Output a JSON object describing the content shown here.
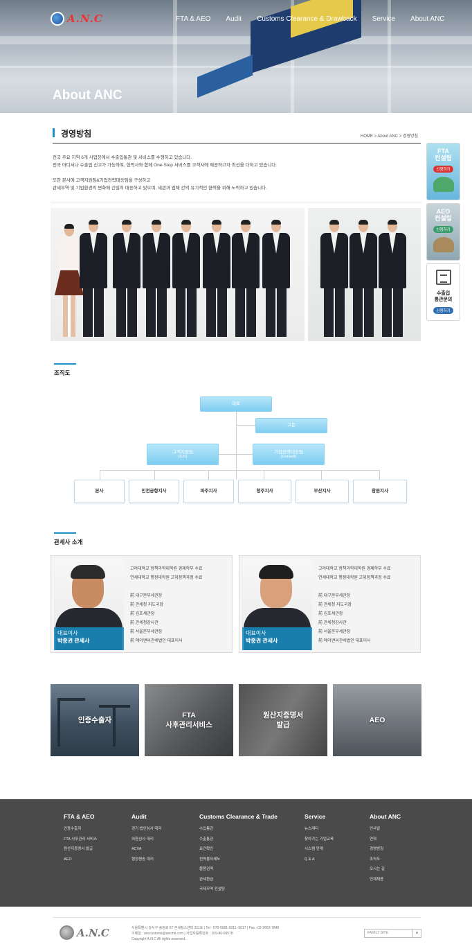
{
  "header": {
    "logo_text": "A.N.C",
    "nav": [
      "FTA & AEO",
      "Audit",
      "Customs Clearance & Drawback",
      "Service",
      "About ANC"
    ],
    "hero_title": "About ANC"
  },
  "page": {
    "title": "경영방침",
    "breadcrumb": "HOME  >  About ANC  >  경영방침",
    "intro": [
      "전국 주요 지역 6개 사업장에서 수출입통관 및 서비스를 수행하고 있습니다.",
      "전국 어디서나 수출입 신고가 가능하며, 협력사와 함께 One-Stop 서비스를 고객사에 제공하고자 최선을 다하고 있습니다.",
      "",
      "또한 본사에 고객지원팀&기업전략대응팀을 구성하고",
      "관세무역 및 기업환경의 변화에 긴밀히 대응하고 있으며, 세관과 업체 간의 유기적인 협력을 위해 노력하고 있습니다."
    ]
  },
  "quick_banners": [
    {
      "label": "FTA\n컨설팅",
      "pill": "신청하기",
      "icon": "globe-coin-icon"
    },
    {
      "label": "AEO\n컨설팅",
      "pill": "신청하기",
      "icon": "house-icon"
    },
    {
      "label": "수출입\n통관문의",
      "pill": "신청하기",
      "icon": "document-icon"
    }
  ],
  "org": {
    "heading": "조직도",
    "ceo": "대표",
    "advisor": "고문",
    "teams": [
      {
        "name": "고객지원팀",
        "sub": "(C/S)"
      },
      {
        "name": "기업전략대응팀",
        "sub": "(Consult)"
      }
    ],
    "branches": [
      "본사",
      "인천공항지사",
      "파주지사",
      "청주지사",
      "부산지사",
      "창원지사"
    ]
  },
  "brokers": {
    "heading": "관세사 소개",
    "items": [
      {
        "role": "대표이사",
        "name": "박종권 관세사",
        "edu": [
          "고려대학교 정책과학대학원 경제학부 수료",
          "연세대학교 행정대학원 고위정책과정 수료"
        ],
        "career": [
          "前 대구본부세관장",
          "前 관세청 지도국장",
          "前 김포세관장",
          "前 관세청감사관",
          "前 서울본부세관장",
          "前 에이엔씨관세법인 대표이사"
        ]
      },
      {
        "role": "대표이사",
        "name": "박종권 관세사",
        "edu": [
          "고려대학교 정책과학대학원 경제학부 수료",
          "연세대학교 행정대학원 고위정책과정 수료"
        ],
        "career": [
          "前 대구본부세관장",
          "前 관세청 지도국장",
          "前 김포세관장",
          "前 관세청감사관",
          "前 서울본부세관장",
          "前 에이엔씨관세법인 대표이사"
        ]
      }
    ]
  },
  "tiles": [
    {
      "line1": "인증수출자",
      "line2": ""
    },
    {
      "line1": "FTA",
      "line2": "사후관리서비스"
    },
    {
      "line1": "원산지증명서",
      "line2": "발급"
    },
    {
      "line1": "AEO",
      "line2": ""
    }
  ],
  "footer": {
    "columns": [
      {
        "title": "FTA & AEO",
        "items": [
          "인증수출자",
          "FTA 사후관리 서비스",
          "원산지증명서 발급",
          "AEO"
        ]
      },
      {
        "title": "Audit",
        "items": [
          "경기 법인심사 대리",
          "외환심사 대리",
          "ACVA",
          "행정쟁송 대리"
        ]
      },
      {
        "title": "Customs Clearance & Trade",
        "items": [
          "수입통관",
          "수출통관",
          "요건확인",
          "전략물자제도",
          "물품검역",
          "관세환급",
          "국제무역 컨설팅"
        ]
      },
      {
        "title": "Service",
        "items": [
          "뉴스레터",
          "찾아가는 기업교육",
          "시스템 연계",
          "Q & A"
        ]
      },
      {
        "title": "About ANC",
        "items": [
          "인사말",
          "연혁",
          "경영방침",
          "조직도",
          "오시는 길",
          "인재채용"
        ]
      }
    ],
    "logo_text": "A.N.C",
    "address": [
      "서울특별시 강서구 송정로 67 관세청스센터 311호  |  Tel : 070-5691-5011~5017  |  Fax : 02-2663-7848",
      "이메일 : anccustoms@ancmil.com  |  사업자등록번호 : 109-86-09578",
      "Copyright A.N.C All rights reserved."
    ],
    "family_site": "FAMILY SITE"
  }
}
